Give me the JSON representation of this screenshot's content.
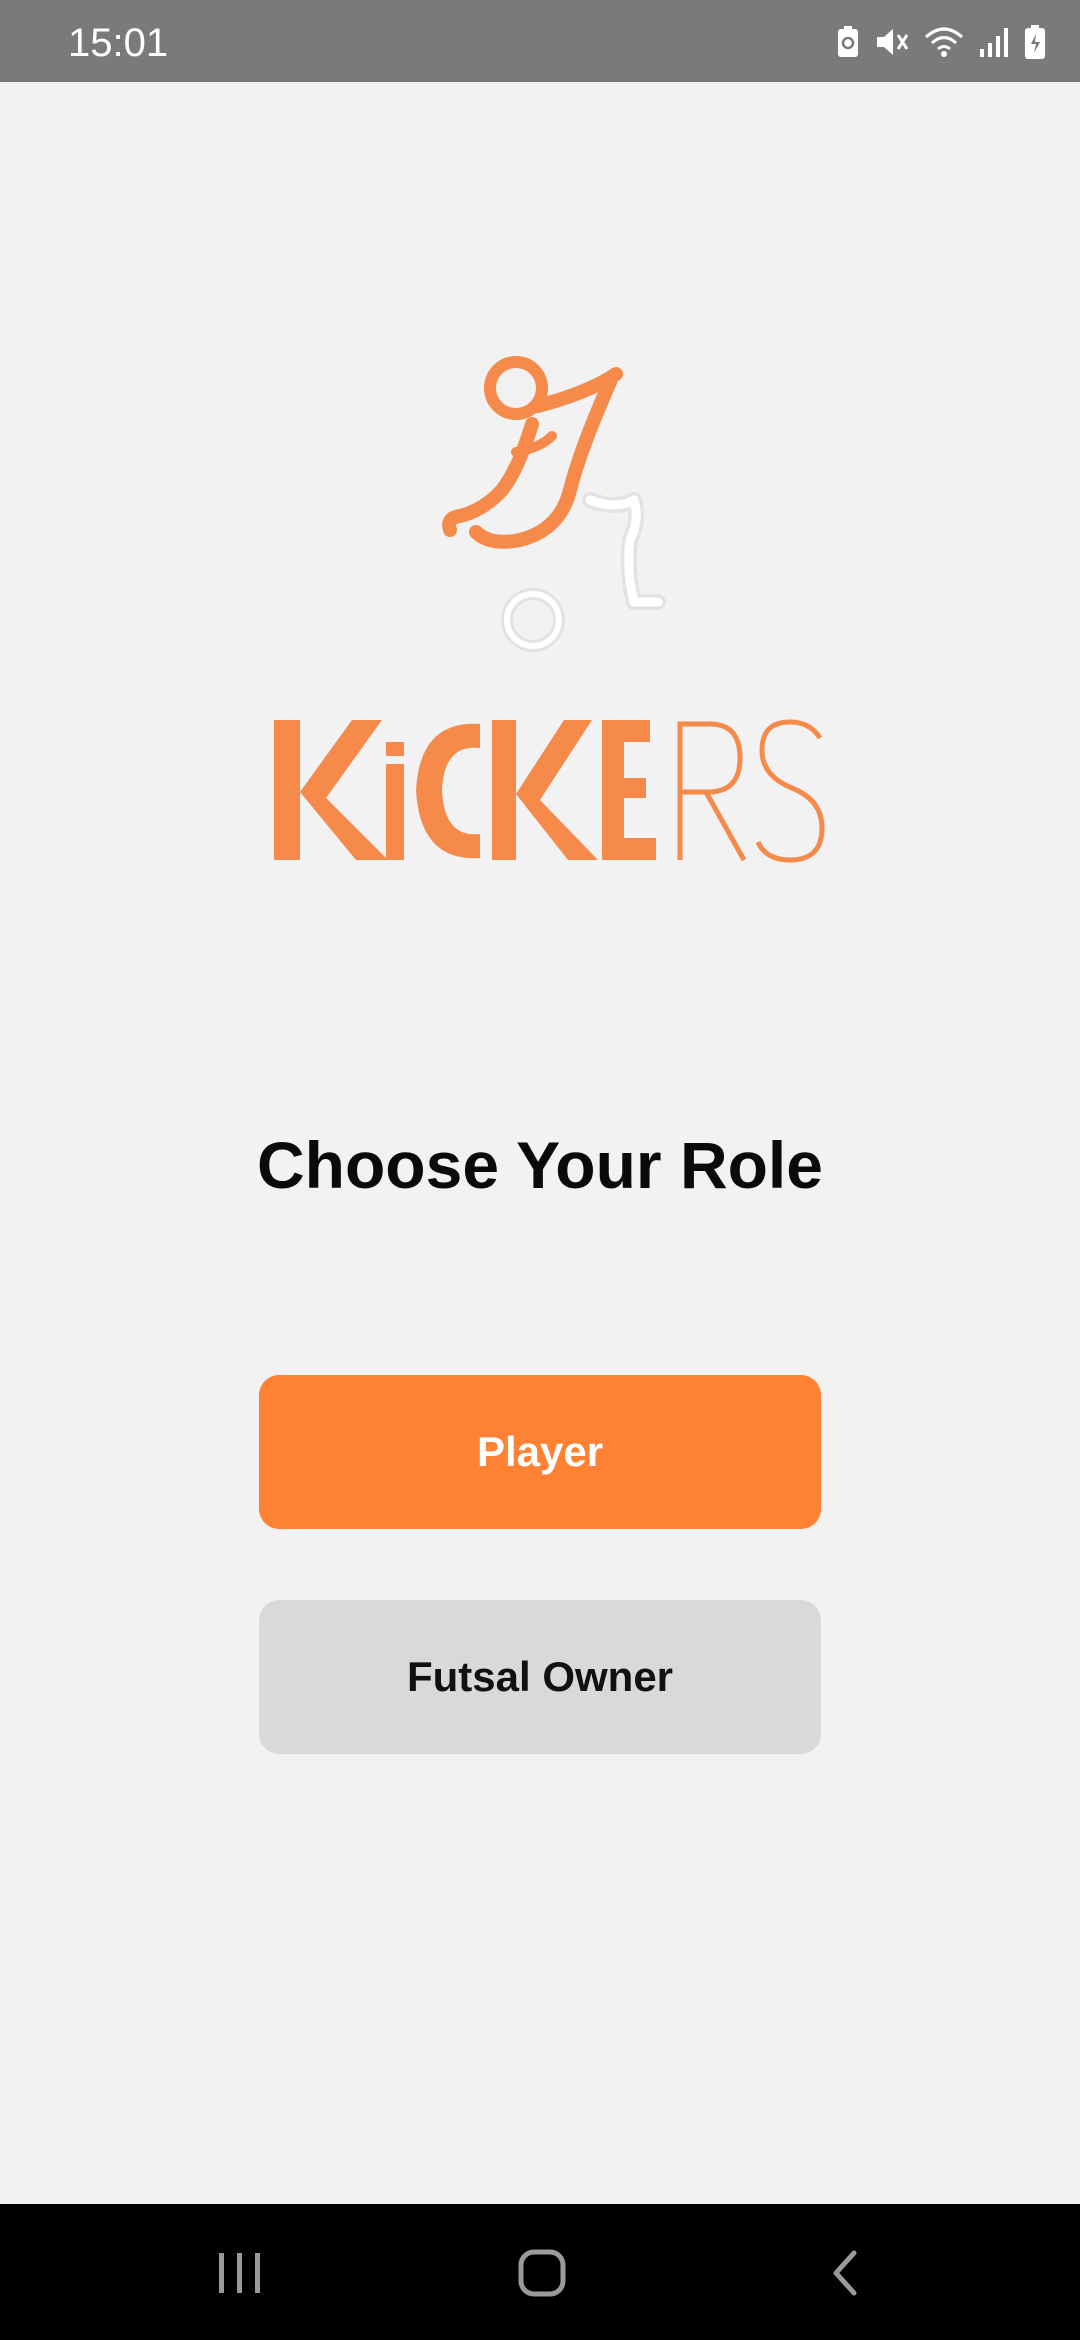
{
  "status_bar": {
    "time": "15:01",
    "icons": [
      "battery-saver-icon",
      "mute-icon",
      "wifi-icon",
      "signal-icon",
      "battery-charging-icon"
    ]
  },
  "logo": {
    "brand_text": "KICKERS",
    "colors": {
      "orange": "#f58a4b",
      "white_outline": "#ffffff",
      "gray_outline": "#e0e0e0"
    }
  },
  "main": {
    "heading": "Choose Your Role",
    "buttons": {
      "player": "Player",
      "futsal_owner": "Futsal Owner"
    }
  },
  "nav_bar": {
    "icons": [
      "recents-icon",
      "home-icon",
      "back-icon"
    ]
  },
  "colors": {
    "accent": "#ff8133",
    "secondary_button": "#d9d9d9",
    "background": "#f2f2f2",
    "status_bar": "#7a7a7a"
  }
}
